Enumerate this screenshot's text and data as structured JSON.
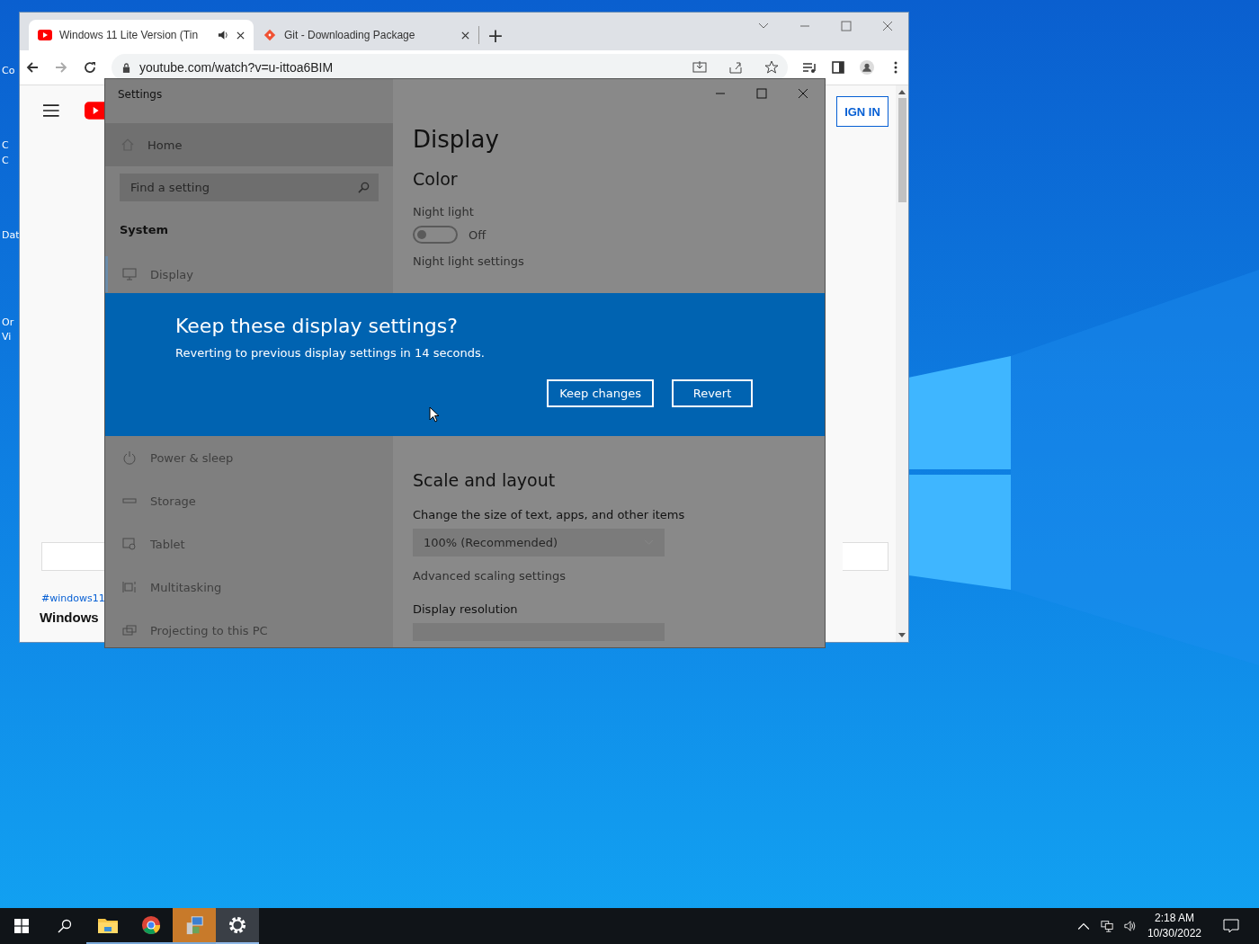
{
  "desktop": {
    "labels": [
      "Co",
      "C",
      "C",
      "Dat",
      "Or",
      "Vi"
    ]
  },
  "browser": {
    "tabs": [
      {
        "title": "Windows 11 Lite Version (Tin",
        "selected": true,
        "audio": true,
        "kind": "youtube"
      },
      {
        "title": "Git - Downloading Package",
        "selected": false,
        "audio": false,
        "kind": "git"
      }
    ],
    "new_tab": "+",
    "url": "youtube.com/watch?v=u-ittoa6BIM",
    "page": {
      "sign_in": "IGN IN",
      "hashtag": "#windows11",
      "video_title": "Windows"
    }
  },
  "settings": {
    "title": "Settings",
    "home": "Home",
    "search_placeholder": "Find a setting",
    "section": "System",
    "nav": [
      {
        "label": "Display",
        "selected": true
      }
    ],
    "nav_below": [
      {
        "label": "Power & sleep",
        "selected": false
      },
      {
        "label": "Storage",
        "selected": false
      },
      {
        "label": "Tablet",
        "selected": false
      },
      {
        "label": "Multitasking",
        "selected": false
      },
      {
        "label": "Projecting to this PC",
        "selected": false
      }
    ],
    "heading": "Display",
    "color_heading": "Color",
    "night_light_label": "Night light",
    "night_light": {
      "on": false,
      "state_text": "Off"
    },
    "night_light_settings": "Night light settings",
    "scale_heading": "Scale and layout",
    "scale_label": "Change the size of text, apps, and other items",
    "scale_value": "100% (Recommended)",
    "advanced_link": "Advanced scaling settings",
    "resolution_label": "Display resolution"
  },
  "dialog": {
    "title": "Keep these display settings?",
    "message": "Reverting to previous display settings in 14 seconds.",
    "buttons": [
      "Keep changes",
      "Revert"
    ]
  },
  "taskbar": {
    "apps": [
      {
        "kind": "start",
        "running": false,
        "flashing": false,
        "selected": false
      },
      {
        "kind": "search",
        "running": false,
        "flashing": false,
        "selected": false
      },
      {
        "kind": "explorer",
        "running": true,
        "flashing": false,
        "selected": false
      },
      {
        "kind": "chrome",
        "running": true,
        "flashing": false,
        "selected": false
      },
      {
        "kind": "installer",
        "running": true,
        "flashing": true,
        "selected": false
      },
      {
        "kind": "settings",
        "running": true,
        "flashing": false,
        "selected": true
      }
    ],
    "time": "2:18 AM",
    "date": "10/30/2022"
  }
}
